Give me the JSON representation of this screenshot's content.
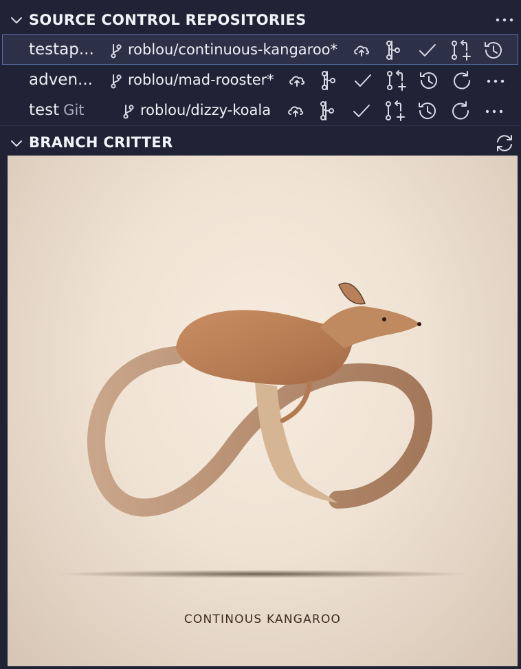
{
  "scm": {
    "title": "SOURCE CONTROL REPOSITORIES",
    "repos": [
      {
        "name": "testap...",
        "subtitle": "",
        "branch": "roblou/continuous-kangaroo*",
        "selected": true
      },
      {
        "name": "adven...",
        "subtitle": "",
        "branch": "roblou/mad-rooster*",
        "selected": false
      },
      {
        "name": "test",
        "subtitle": "Git",
        "branch": "roblou/dizzy-koala",
        "selected": false
      }
    ]
  },
  "critter": {
    "title": "BRANCH CRITTER",
    "caption": "CONTINOUS KANGAROO",
    "image": "kangaroo with a looping infinity-shaped tail"
  },
  "icons": {
    "collapse": "chevron-down-icon",
    "more": "ellipsis-icon",
    "branch": "git-branch-icon",
    "publish": "cloud-upload-icon",
    "compare": "git-compare-icon",
    "commit": "check-icon",
    "pull_request": "git-pull-request-create-icon",
    "history": "history-icon",
    "refresh": "refresh-icon",
    "sync": "sync-icon"
  },
  "colors": {
    "background": "#1f2335",
    "selected_row": "#2c3147",
    "selected_border": "#5c6fa8",
    "text": "#e6e9f2"
  }
}
